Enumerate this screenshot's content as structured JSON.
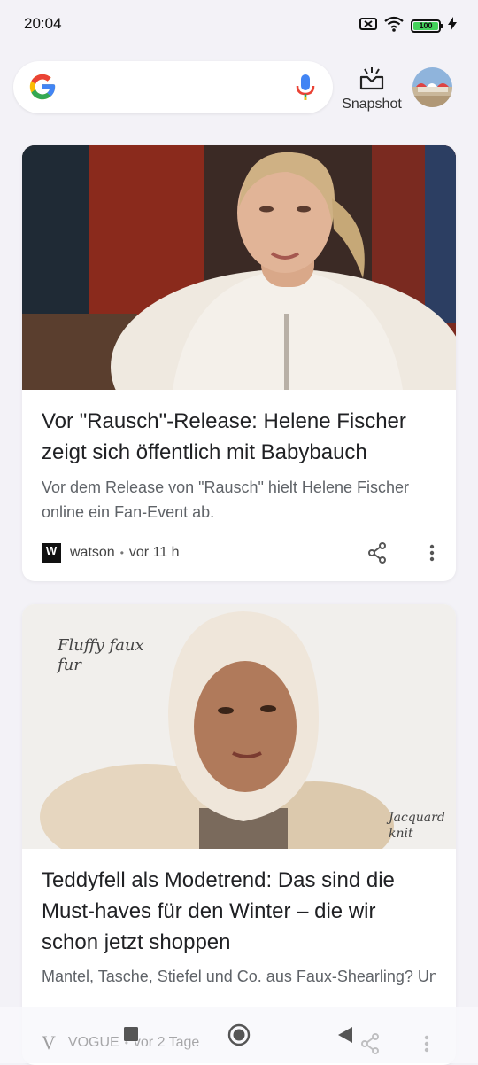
{
  "status_bar": {
    "time": "20:04",
    "battery": "100"
  },
  "search": {
    "placeholder": "",
    "snapshot_label": "Snapshot"
  },
  "feed": [
    {
      "title": "Vor \"Rausch\"-Release: Helene Fischer zeigt sich öffentlich mit Babybauch",
      "snippet": "Vor dem Release von \"Rausch\" hielt Helene Fischer online ein Fan-Event ab.",
      "source": "watson",
      "source_logo": "W",
      "age": "vor 11 h"
    },
    {
      "title": "Teddyfell als Modetrend: Das sind die Must-haves für den Winter – die wir schon jetzt shoppen",
      "snippet": "Mantel, Tasche, Stiefel und Co. aus Faux-Shearling? Unbedingt! Wir zeigen Ihnen, mit welchen It-Pieces…",
      "source": "VOGUE",
      "source_logo": "V",
      "age": "vor 2 Tage",
      "image_text_1": "Fluffy faux fur",
      "image_text_2": "Jacquard knit"
    }
  ],
  "colors": {
    "google_blue": "#4285F4",
    "google_red": "#EA4335",
    "google_yellow": "#FBBC05",
    "google_green": "#34A853",
    "battery_green": "#43d15a"
  },
  "icons": [
    "google-logo-icon",
    "mic-icon",
    "snapshot-icon",
    "share-icon",
    "more-vert-icon",
    "recents-icon",
    "home-icon",
    "back-icon",
    "wifi-icon",
    "battery-icon",
    "charging-icon",
    "sim-off-icon"
  ]
}
